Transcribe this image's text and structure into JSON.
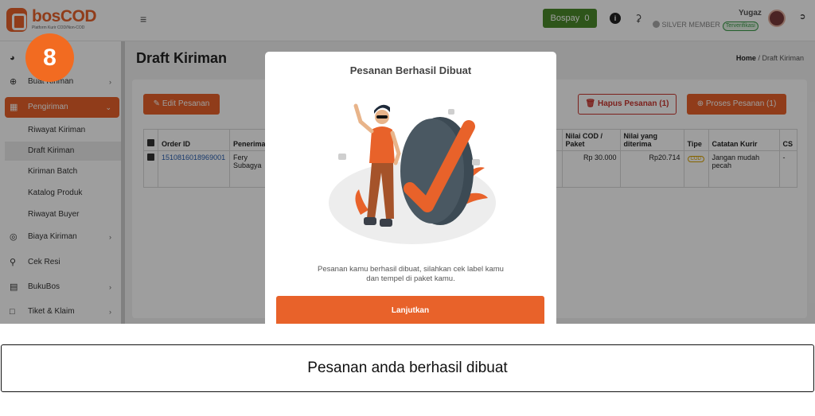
{
  "header": {
    "logo_text": "bosCOD",
    "logo_sub": "Platform Kurir COD/Non-COD",
    "bospay_label": "Bospay",
    "bospay_value": "0",
    "username": "Yugaz",
    "membership": "SILVER MEMBER",
    "verified_label": "Terverifikasi"
  },
  "step_badge": "8",
  "sidebar": {
    "items": [
      {
        "label": "Buat Kiriman"
      },
      {
        "label": "Pengiriman"
      },
      {
        "label": "Biaya Kiriman"
      },
      {
        "label": "Cek Resi"
      },
      {
        "label": "BukuBos"
      },
      {
        "label": "Tiket & Klaim"
      }
    ],
    "sub_items": [
      {
        "label": "Riwayat Kiriman"
      },
      {
        "label": "Draft Kiriman"
      },
      {
        "label": "Kiriman Batch"
      },
      {
        "label": "Katalog Produk"
      },
      {
        "label": "Riwayat Buyer"
      }
    ]
  },
  "main": {
    "title": "Draft Kiriman",
    "breadcrumb_home": "Home",
    "breadcrumb_sep": "/",
    "breadcrumb_current": "Draft Kiriman",
    "edit_button": "Edit Pesanan",
    "delete_button": "Hapus Pesanan (1)",
    "process_button": "Proses Pesanan (1)"
  },
  "table": {
    "headers": [
      "Order ID",
      "Penerima",
      "Nilai COD / Paket",
      "Nilai yang diterima",
      "Tipe",
      "Catatan Kurir",
      "CS"
    ],
    "row": {
      "order_id": "1510816018969001",
      "recipient": "Fery Subagya",
      "cod_value": "Rp 30.000",
      "received": "Rp20.714",
      "type": "COD",
      "note": "Jangan mudah pecah",
      "cs": "-"
    }
  },
  "modal": {
    "title": "Pesanan Berhasil Dibuat",
    "message": "Pesanan kamu berhasil dibuat, silahkan cek label kamu dan tempel di paket kamu.",
    "continue_button": "Lanjutkan"
  },
  "caption": "Pesanan anda berhasil dibuat",
  "colors": {
    "accent": "#e8622a",
    "bospay": "#4b8a2b",
    "danger": "#c8352e"
  }
}
